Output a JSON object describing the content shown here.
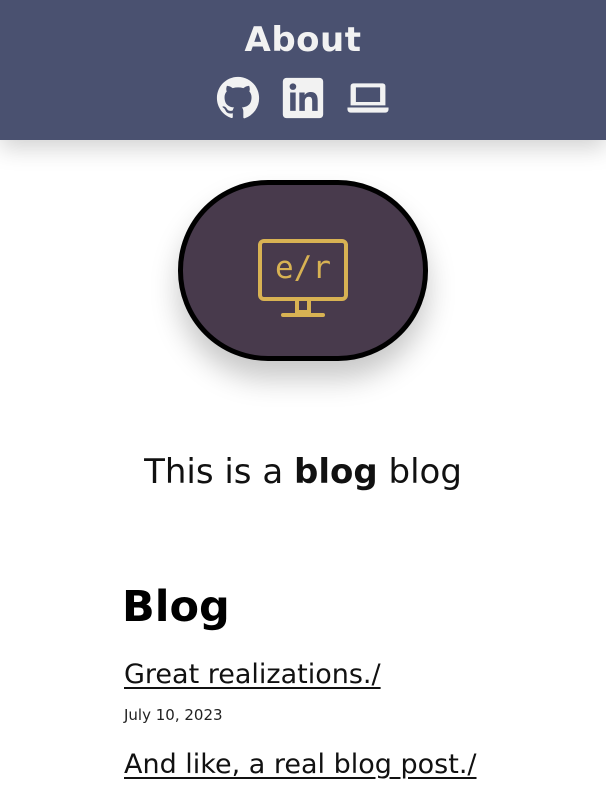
{
  "header": {
    "about_label": "About",
    "icons": [
      {
        "name": "github-icon"
      },
      {
        "name": "linkedin-icon"
      },
      {
        "name": "laptop-icon"
      }
    ],
    "background_color": "#4a5170"
  },
  "avatar": {
    "logo_text": "e/r",
    "background_color": "#483a4c",
    "accent_color": "#d8b253"
  },
  "intro": {
    "prefix": "This is a ",
    "emphasis": "blog",
    "suffix": " blog"
  },
  "blog": {
    "heading": "Blog",
    "posts": [
      {
        "title": "Great realizations./",
        "date": "July 10, 2023"
      },
      {
        "title": "And like, a real blog post./"
      }
    ]
  }
}
